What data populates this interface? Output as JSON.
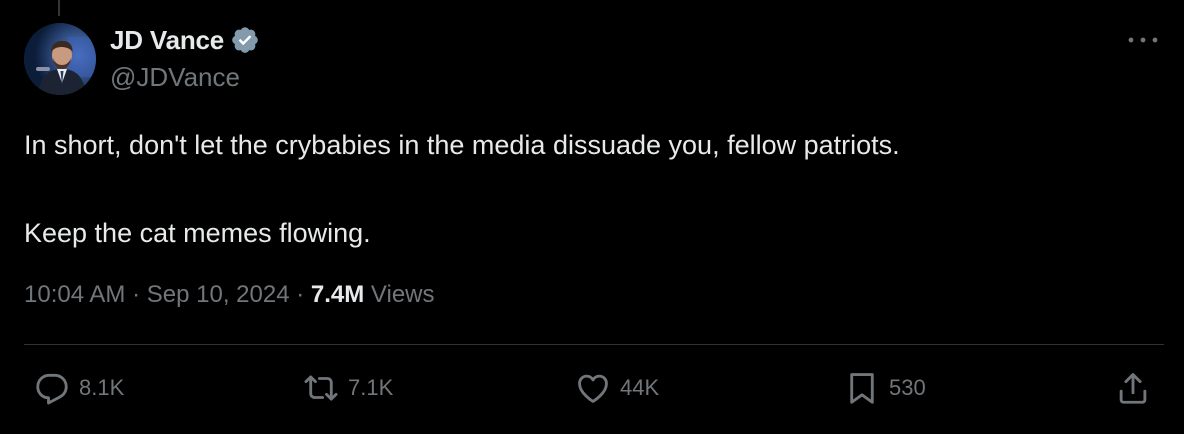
{
  "author": {
    "display_name": "JD Vance",
    "handle": "@JDVance",
    "verified_icon": "verified-badge-icon",
    "verified_color": "#829aab"
  },
  "tweet": {
    "lines": [
      "In short, don't let the crybabies in the media dissuade you, fellow patriots.",
      "Keep the cat memes flowing."
    ]
  },
  "meta": {
    "time": "10:04 AM",
    "separator": "·",
    "date": "Sep 10, 2024",
    "views_count": "7.4M",
    "views_label": "Views"
  },
  "actions": {
    "replies": "8.1K",
    "reposts": "7.1K",
    "likes": "44K",
    "bookmarks": "530"
  },
  "colors": {
    "background": "#000000",
    "text": "#e7e9ea",
    "secondary": "#71767b",
    "divider": "#2f3336"
  }
}
